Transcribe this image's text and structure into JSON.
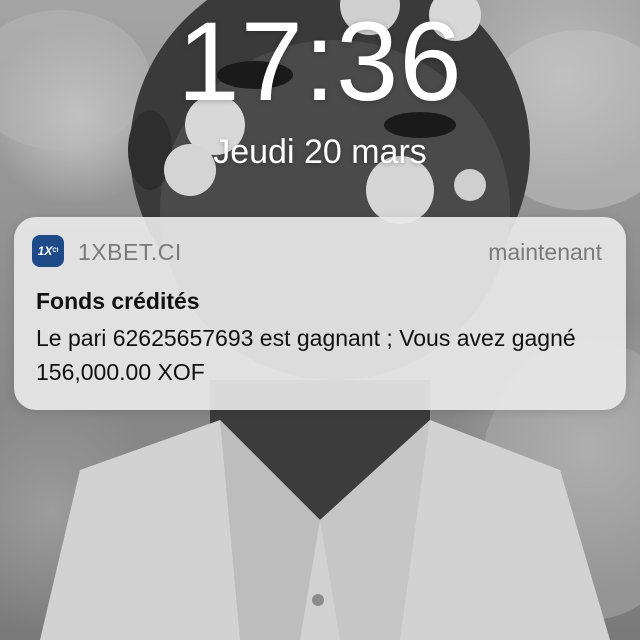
{
  "lock_screen": {
    "time": "17:36",
    "date": "Jeudi 20 mars"
  },
  "notification": {
    "app_icon": {
      "icon": "1xbet-app-icon",
      "text": "1X",
      "subtext": "CI",
      "color": "#1f4a8a"
    },
    "app_name": "1XBET.CI",
    "timestamp": "maintenant",
    "title": "Fonds crédités",
    "body": "Le pari 62625657693 est gagnant ; Vous avez gagné 156,000.00 XOF"
  },
  "wallpaper": {
    "description_icon": "photo-wallpaper",
    "tone": "grayscale"
  }
}
